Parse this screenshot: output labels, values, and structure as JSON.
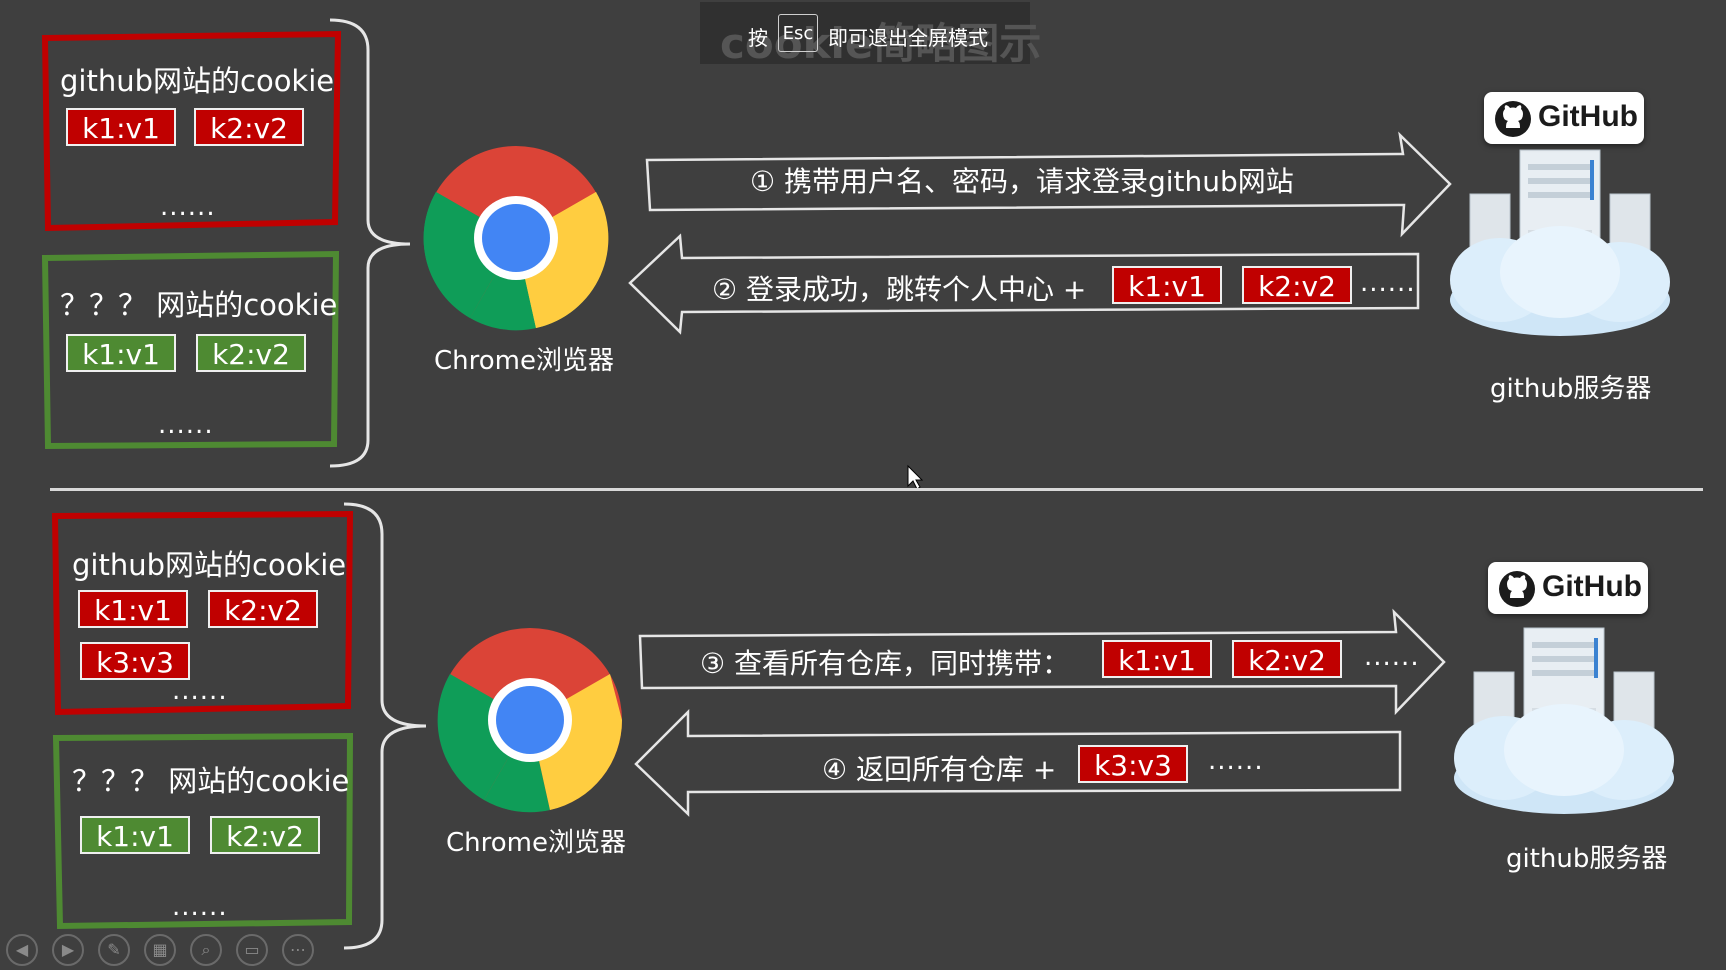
{
  "banner": {
    "prefix": "按",
    "key": "Esc",
    "suffix": "即可退出全屏模式",
    "background_title": "cookie简略图示"
  },
  "top": {
    "github_cookie_title": "github网站的cookie",
    "other_cookie_title": "？？？ 网站的cookie",
    "github_tags": [
      "k1:v1",
      "k2:v2"
    ],
    "other_tags": [
      "k1:v1",
      "k2:v2"
    ],
    "dots": "......",
    "browser_label": "Chrome浏览器",
    "server_label": "github服务器",
    "github_logo": "GitHub",
    "request_text": "① 携带用户名、密码，请求登录github网站",
    "response_text": "② 登录成功，跳转个人中心 +",
    "response_tags": [
      "k1:v1",
      "k2:v2"
    ],
    "response_dots": "......"
  },
  "bottom": {
    "github_cookie_title": "github网站的cookie",
    "other_cookie_title": "？？？ 网站的cookie",
    "github_tags": [
      "k1:v1",
      "k2:v2",
      "k3:v3"
    ],
    "other_tags": [
      "k1:v1",
      "k2:v2"
    ],
    "dots": "......",
    "browser_label": "Chrome浏览器",
    "server_label": "github服务器",
    "github_logo": "GitHub",
    "request_text": "③ 查看所有仓库，同时携带：",
    "request_tags": [
      "k1:v1",
      "k2:v2"
    ],
    "request_dots": "......",
    "response_text": "④ 返回所有仓库 +",
    "response_tags": [
      "k3:v3"
    ],
    "response_dots": "......"
  },
  "controls": [
    "prev-icon",
    "next-icon",
    "pen-icon",
    "slides-icon",
    "zoom-icon",
    "subtitle-icon",
    "more-icon"
  ],
  "colors": {
    "background": "#3f3f3f",
    "github_border": "#c00000",
    "other_border": "#4e8a32",
    "red_tag": "#c00000",
    "green_tag": "#4e8a32"
  }
}
